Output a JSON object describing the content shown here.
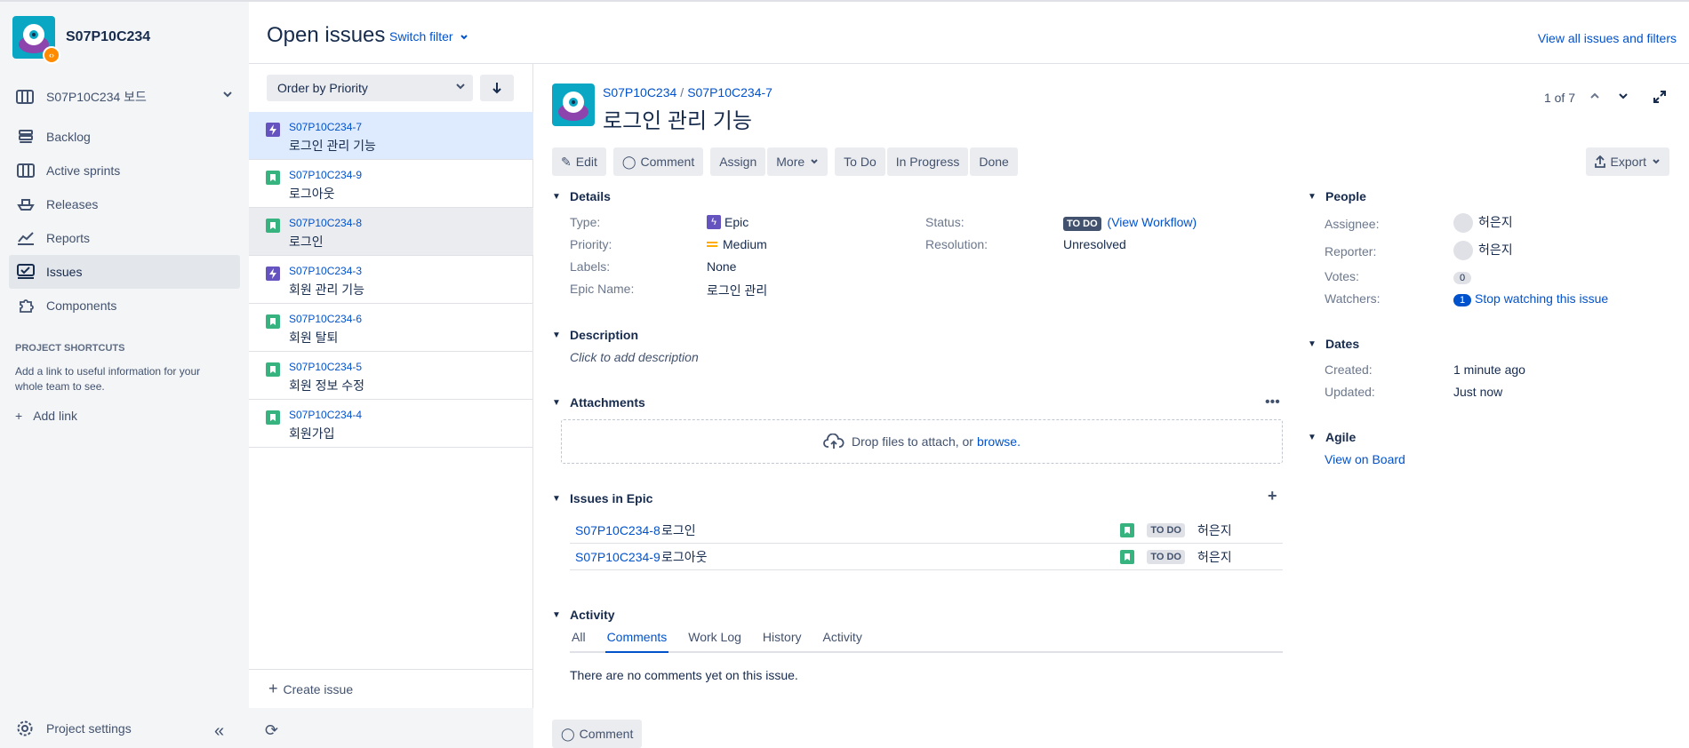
{
  "sidebar": {
    "project_name": "S07P10C234",
    "board_label": "S07P10C234 보드",
    "nav": [
      {
        "label": "Backlog"
      },
      {
        "label": "Active sprints"
      },
      {
        "label": "Releases"
      },
      {
        "label": "Reports"
      },
      {
        "label": "Issues"
      },
      {
        "label": "Components"
      }
    ],
    "shortcuts_heading": "PROJECT SHORTCUTS",
    "shortcuts_text": "Add a link to useful information for your whole team to see.",
    "add_link": "Add link",
    "settings": "Project settings"
  },
  "header": {
    "title": "Open issues",
    "switch_filter": "Switch filter",
    "view_all": "View all issues and filters"
  },
  "list": {
    "order_by": "Order by Priority",
    "items": [
      {
        "key": "S07P10C234-7",
        "summary": "로그인 관리 기능",
        "type": "epic"
      },
      {
        "key": "S07P10C234-9",
        "summary": "로그아웃",
        "type": "story"
      },
      {
        "key": "S07P10C234-8",
        "summary": "로그인",
        "type": "story"
      },
      {
        "key": "S07P10C234-3",
        "summary": "회원 관리 기능",
        "type": "epic"
      },
      {
        "key": "S07P10C234-6",
        "summary": "회원 탈퇴",
        "type": "story"
      },
      {
        "key": "S07P10C234-5",
        "summary": "회원 정보 수정",
        "type": "story"
      },
      {
        "key": "S07P10C234-4",
        "summary": "회원가입",
        "type": "story"
      }
    ],
    "create_issue": "Create issue"
  },
  "detail": {
    "breadcrumb_project": "S07P10C234",
    "breadcrumb_key": "S07P10C234-7",
    "title": "로그인 관리 기능",
    "pager": "1 of 7",
    "toolbar": {
      "edit": "Edit",
      "comment": "Comment",
      "assign": "Assign",
      "more": "More",
      "todo": "To Do",
      "in_progress": "In Progress",
      "done": "Done",
      "export": "Export"
    },
    "details": {
      "heading": "Details",
      "type_label": "Type:",
      "type_value": "Epic",
      "priority_label": "Priority:",
      "priority_value": "Medium",
      "labels_label": "Labels:",
      "labels_value": "None",
      "epic_name_label": "Epic Name:",
      "epic_name_value": "로그인 관리",
      "status_label": "Status:",
      "status_value": "TO DO",
      "view_workflow": "(View Workflow)",
      "resolution_label": "Resolution:",
      "resolution_value": "Unresolved"
    },
    "description": {
      "heading": "Description",
      "placeholder": "Click to add description"
    },
    "attachments": {
      "heading": "Attachments",
      "drop_text": "Drop files to attach, or",
      "browse": "browse."
    },
    "issues_in_epic": {
      "heading": "Issues in Epic",
      "rows": [
        {
          "key": "S07P10C234-8",
          "summary": "로그인",
          "status": "TO DO",
          "assignee": "허은지"
        },
        {
          "key": "S07P10C234-9",
          "summary": "로그아웃",
          "status": "TO DO",
          "assignee": "허은지"
        }
      ]
    },
    "activity": {
      "heading": "Activity",
      "tabs": [
        "All",
        "Comments",
        "Work Log",
        "History",
        "Activity"
      ],
      "empty": "There are no comments yet on this issue.",
      "comment_button": "Comment"
    },
    "people": {
      "heading": "People",
      "assignee_label": "Assignee:",
      "assignee": "허은지",
      "reporter_label": "Reporter:",
      "reporter": "허은지",
      "votes_label": "Votes:",
      "votes": "0",
      "watchers_label": "Watchers:",
      "watchers": "1",
      "stop_watching": "Stop watching this issue"
    },
    "dates": {
      "heading": "Dates",
      "created_label": "Created:",
      "created": "1 minute ago",
      "updated_label": "Updated:",
      "updated": "Just now"
    },
    "agile": {
      "heading": "Agile",
      "link": "View on Board"
    }
  },
  "colors": {
    "epic": "#6554C0",
    "story": "#36B37E",
    "link": "#0052CC",
    "medium_priority": "#FFAB00"
  }
}
